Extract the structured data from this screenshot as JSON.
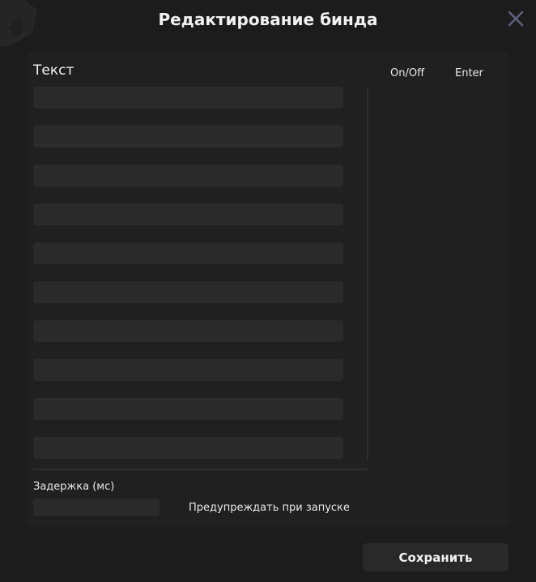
{
  "dialog": {
    "title": "Редактирование бинда",
    "close_icon": "close-icon"
  },
  "editor": {
    "text_label": "Текст",
    "columns": {
      "on_off": "On/Off",
      "enter": "Enter"
    },
    "rows": [
      {
        "value": ""
      },
      {
        "value": ""
      },
      {
        "value": ""
      },
      {
        "value": ""
      },
      {
        "value": ""
      },
      {
        "value": ""
      },
      {
        "value": ""
      },
      {
        "value": ""
      },
      {
        "value": ""
      },
      {
        "value": ""
      }
    ]
  },
  "delay": {
    "label": "Задержка (мс)",
    "value": ""
  },
  "warn_on_start": {
    "label": "Предупреждать при запуске"
  },
  "actions": {
    "save_label": "Сохранить"
  },
  "colors": {
    "background": "#1c1c1d",
    "panel": "#202021",
    "field": "#2b2b2c",
    "text": "#ececec",
    "close_icon": "#5f5f79"
  }
}
